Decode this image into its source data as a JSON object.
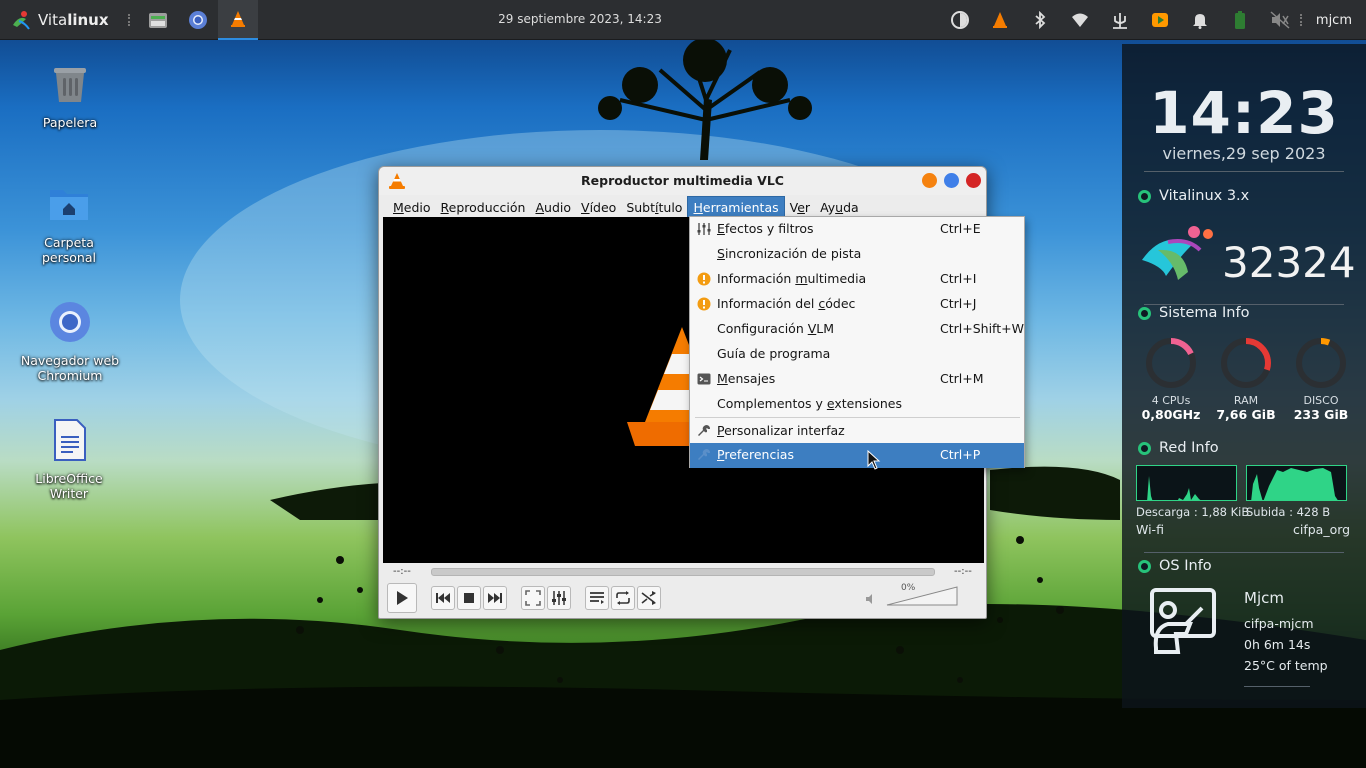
{
  "panel": {
    "brand_prefix": "Vita",
    "brand_bold": "linux",
    "datetime": "29 septiembre 2023, 14:23",
    "user": "mjcm"
  },
  "desktop": {
    "icons": [
      {
        "label": "Papelera"
      },
      {
        "label": "Carpeta personal"
      },
      {
        "label": "Navegador web Chromium"
      },
      {
        "label": "LibreOffice Writer"
      }
    ]
  },
  "conky": {
    "time": "14:23",
    "date": "viernes,29 sep 2023",
    "vitalinux_title": "Vitalinux 3.x",
    "counter": "32324",
    "system_title": "Sistema Info",
    "gauges": [
      {
        "label": "4 CPUs",
        "value": "0,80GHz",
        "percent": 0.18,
        "color": "#f06292"
      },
      {
        "label": "RAM",
        "value": "7,66 GiB",
        "percent": 0.3,
        "color": "#e53935"
      },
      {
        "label": "DISCO",
        "value": "233 GiB",
        "percent": 0.06,
        "color": "#ff9800"
      }
    ],
    "net_title": "Red Info",
    "download": "Descarga : 1,88 KiB",
    "upload": "Subida : 428 B",
    "wifi_label": "Wi-fi",
    "ssid": "cifpa_org",
    "os_title": "OS Info",
    "os_user": "Mjcm",
    "hostname": "cifpa-mjcm",
    "uptime": "0h 6m 14s",
    "temp": "25°C of temp"
  },
  "vlc": {
    "title": "Reproductor multimedia VLC",
    "menu": [
      {
        "pre": "",
        "u": "M",
        "post": "edio"
      },
      {
        "pre": "",
        "u": "R",
        "post": "eproducción"
      },
      {
        "pre": "",
        "u": "A",
        "post": "udio"
      },
      {
        "pre": "",
        "u": "V",
        "post": "ídeo"
      },
      {
        "pre": "Subt",
        "u": "í",
        "post": "tulo"
      },
      {
        "pre": "",
        "u": "H",
        "post": "erramientas"
      },
      {
        "pre": "V",
        "u": "e",
        "post": "r"
      },
      {
        "pre": "Ay",
        "u": "u",
        "post": "da"
      }
    ],
    "time_elapsed": "--:--",
    "time_total": "--:--",
    "volume": "0%",
    "volume_level": 0.0
  },
  "tools_menu": {
    "items": [
      {
        "pre": "",
        "u": "E",
        "post": "fectos y filtros",
        "shortcut": "Ctrl+E",
        "icon": "equalizer-icon"
      },
      {
        "pre": "",
        "u": "S",
        "post": "incronización de pista",
        "shortcut": "",
        "icon": ""
      },
      {
        "pre": "Información ",
        "u": "m",
        "post": "ultimedia",
        "shortcut": "Ctrl+I",
        "icon": "info-icon"
      },
      {
        "pre": "Información del ",
        "u": "c",
        "post": "ódec",
        "shortcut": "Ctrl+J",
        "icon": "info-icon"
      },
      {
        "pre": "Configuración ",
        "u": "V",
        "post": "LM",
        "shortcut": "Ctrl+Shift+W",
        "icon": ""
      },
      {
        "pre": "Guía de programa",
        "u": "",
        "post": "",
        "shortcut": "",
        "icon": ""
      },
      {
        "pre": "",
        "u": "M",
        "post": "ensajes",
        "shortcut": "Ctrl+M",
        "icon": "terminal-icon"
      },
      {
        "pre": "Complementos y ",
        "u": "e",
        "post": "xtensiones",
        "shortcut": "",
        "icon": ""
      },
      {
        "pre": "",
        "u": "P",
        "post": "ersonalizar interfaz",
        "shortcut": "",
        "icon": "wrench-icon"
      },
      {
        "pre": "",
        "u": "P",
        "post": "referencias",
        "shortcut": "Ctrl+P",
        "icon": "wrench-icon"
      }
    ]
  }
}
